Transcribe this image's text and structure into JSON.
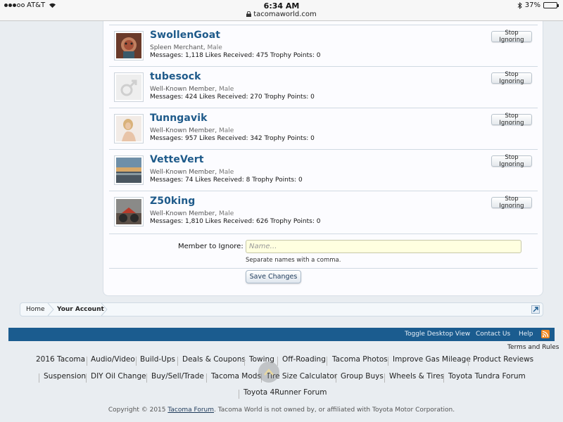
{
  "status_bar": {
    "carrier": "AT&T",
    "time": "6:34 AM",
    "url": "tacomaworld.com",
    "battery": "37%",
    "battery_level": 0.37
  },
  "members": [
    {
      "name": "SwollenGoat",
      "title": "Spleen Merchant",
      "gender": "Male",
      "stats": "Messages: 1,118 Likes Received: 475 Trophy Points: 0",
      "button": "Stop Ignoring",
      "avatar": "goat-portrait"
    },
    {
      "name": "tubesock",
      "title": "Well-Known Member",
      "gender": "Male",
      "stats": "Messages: 424 Likes Received: 270 Trophy Points: 0",
      "button": "Stop Ignoring",
      "avatar": "male-placeholder"
    },
    {
      "name": "Tunngavik",
      "title": "Well-Known Member",
      "gender": "Male",
      "stats": "Messages: 957 Likes Received: 342 Trophy Points: 0",
      "button": "Stop Ignoring",
      "avatar": "person-photo"
    },
    {
      "name": "VetteVert",
      "title": "Well-Known Member",
      "gender": "Male",
      "stats": "Messages: 74 Likes Received: 8 Trophy Points: 0",
      "button": "Stop Ignoring",
      "avatar": "sunset-photo"
    },
    {
      "name": "Z50king",
      "title": "Well-Known Member",
      "gender": "Male",
      "stats": "Messages: 1,810 Likes Received: 626 Trophy Points: 0",
      "button": "Stop Ignoring",
      "avatar": "motorbike-photo"
    }
  ],
  "ignore_form": {
    "label": "Member to Ignore:",
    "placeholder": "Name…",
    "hint": "Separate names with a comma.",
    "save_label": "Save Changes"
  },
  "breadcrumb": {
    "home": "Home",
    "account": "Your Account"
  },
  "footer": {
    "toggle_desktop": "Toggle Desktop View",
    "contact": "Contact Us",
    "help": "Help",
    "terms": "Terms and Rules",
    "links_row1": [
      "2016 Tacoma",
      "Audio/Video",
      "Build-Ups",
      "Deals & Coupons",
      "Towing",
      "Off-Roading",
      "Tacoma Photos",
      "Improve Gas Mileage",
      "Product Reviews"
    ],
    "links_row2": [
      "Suspension",
      "DIY Oil Change",
      "Buy/Sell/Trade",
      "Tacoma Mods",
      "Tire Size Calculator",
      "Group Buys",
      "Wheels & Tires",
      "Toyota Tundra Forum"
    ],
    "links_row3": [
      "Toyota 4Runner Forum"
    ],
    "copyright_prefix": "Copyright © 2015 ",
    "copyright_link": "Tacoma Forum",
    "copyright_suffix": ". Tacoma World is not owned by, or affiliated with Toyota Motor Corporation."
  },
  "colors": {
    "accent": "#1b5c8f",
    "username": "#1e5a8a",
    "input_bg": "#ffffe0"
  }
}
